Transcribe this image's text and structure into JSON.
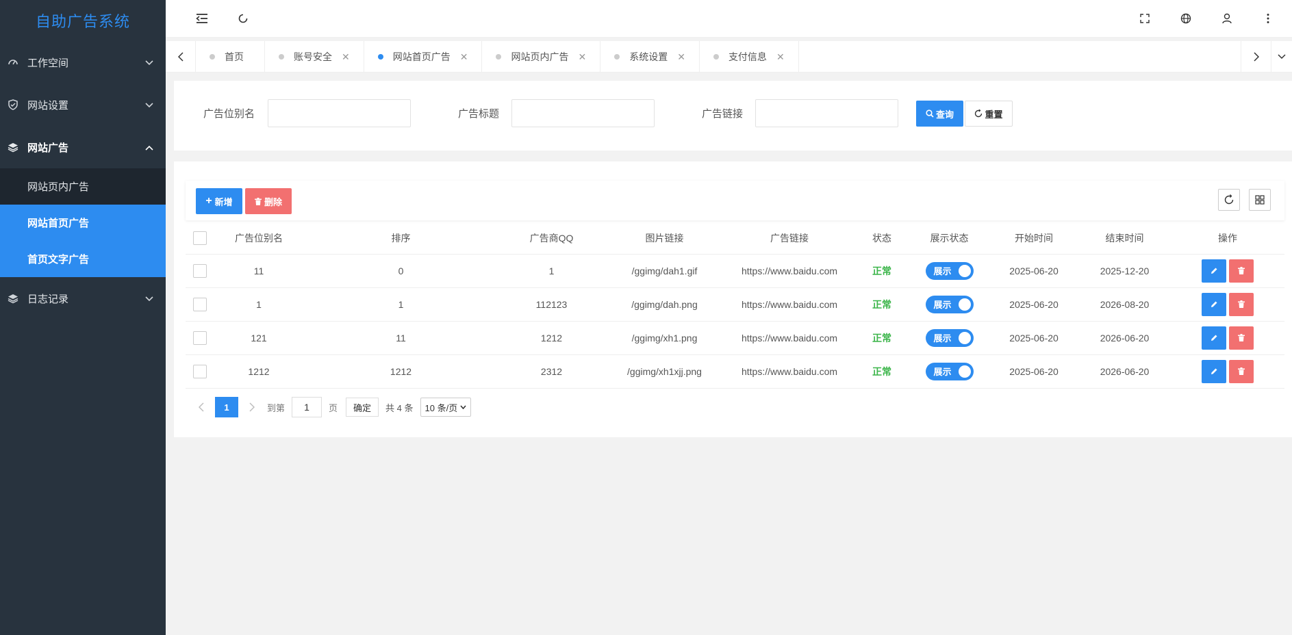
{
  "app": {
    "title": "自助广告系统"
  },
  "sidebar": {
    "groups": [
      {
        "label": "工作空间",
        "icon": "dashboard-icon"
      },
      {
        "label": "网站设置",
        "icon": "shield-check-icon"
      },
      {
        "label": "网站广告",
        "icon": "layers-icon",
        "open": true,
        "items": [
          {
            "label": "网站页内广告"
          },
          {
            "label": "网站首页广告",
            "active": true
          },
          {
            "label": "首页文字广告",
            "active": true
          }
        ]
      },
      {
        "label": "日志记录",
        "icon": "layers-icon"
      }
    ]
  },
  "tabs": [
    {
      "label": "首页"
    },
    {
      "label": "账号安全"
    },
    {
      "label": "网站首页广告",
      "active": true
    },
    {
      "label": "网站页内广告"
    },
    {
      "label": "系统设置"
    },
    {
      "label": "支付信息"
    }
  ],
  "search": {
    "fields": [
      {
        "label": "广告位别名",
        "value": ""
      },
      {
        "label": "广告标题",
        "value": ""
      },
      {
        "label": "广告链接",
        "value": ""
      }
    ],
    "query_label": "查询",
    "reset_label": "重置"
  },
  "toolbar": {
    "add_label": "新增",
    "delete_label": "删除"
  },
  "table": {
    "columns": [
      "广告位别名",
      "排序",
      "广告商QQ",
      "图片链接",
      "广告链接",
      "状态",
      "展示状态",
      "开始时间",
      "结束时间",
      "操作"
    ],
    "rows": [
      {
        "alias": "11",
        "sort": "0",
        "qq": "1",
        "img": "/ggimg/dah1.gif",
        "link": "https://www.baidu.com",
        "status": "正常",
        "display": "展示",
        "start": "2025-06-20",
        "end": "2025-12-20"
      },
      {
        "alias": "1",
        "sort": "1",
        "qq": "112123",
        "img": "/ggimg/dah.png",
        "link": "https://www.baidu.com",
        "status": "正常",
        "display": "展示",
        "start": "2025-06-20",
        "end": "2026-08-20"
      },
      {
        "alias": "121",
        "sort": "11",
        "qq": "1212",
        "img": "/ggimg/xh1.png",
        "link": "https://www.baidu.com",
        "status": "正常",
        "display": "展示",
        "start": "2025-06-20",
        "end": "2026-06-20"
      },
      {
        "alias": "1212",
        "sort": "1212",
        "qq": "2312",
        "img": "/ggimg/xh1xjj.png",
        "link": "https://www.baidu.com",
        "status": "正常",
        "display": "展示",
        "start": "2025-06-20",
        "end": "2026-06-20"
      }
    ]
  },
  "pager": {
    "current": "1",
    "goto_label": "到第",
    "goto_value": "1",
    "page_unit": "页",
    "confirm_label": "确定",
    "total_label": "共 4 条",
    "page_size": "10 条/页"
  },
  "colors": {
    "primary": "#2d8cf0",
    "danger": "#f27070",
    "success": "#3cb54a",
    "sidebar_bg": "#28333e"
  }
}
